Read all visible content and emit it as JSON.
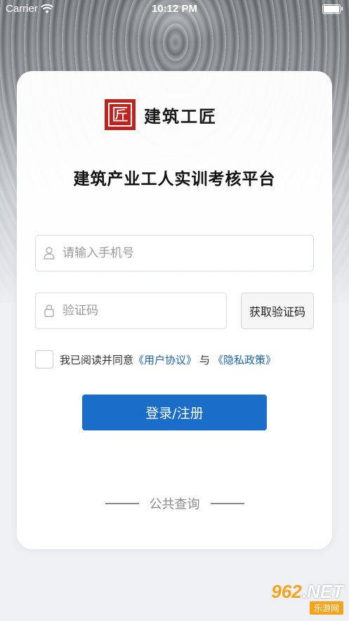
{
  "status_bar": {
    "carrier": "Carrier",
    "time": "10:12 PM"
  },
  "brand": {
    "logo_char": "匠",
    "name": "建筑工匠",
    "logo_color": "#c0221d"
  },
  "title": "建筑产业工人实训考核平台",
  "phone_field": {
    "placeholder": "请输入手机号",
    "icon": "user-icon"
  },
  "code_field": {
    "placeholder": "验证码",
    "icon": "lock-icon"
  },
  "get_code_button": "获取验证码",
  "agreement": {
    "prefix": "我已阅读并同意",
    "user_agreement": "《用户协议》",
    "conjunction": "与",
    "privacy_policy": "《隐私政策》"
  },
  "login_button": "登录/注册",
  "public_query": "公共查询",
  "watermark": {
    "top": "962",
    "top_suffix": ".NET",
    "bottom": "乐游网"
  },
  "colors": {
    "primary": "#1a6dc9",
    "link": "#1a63b9"
  }
}
